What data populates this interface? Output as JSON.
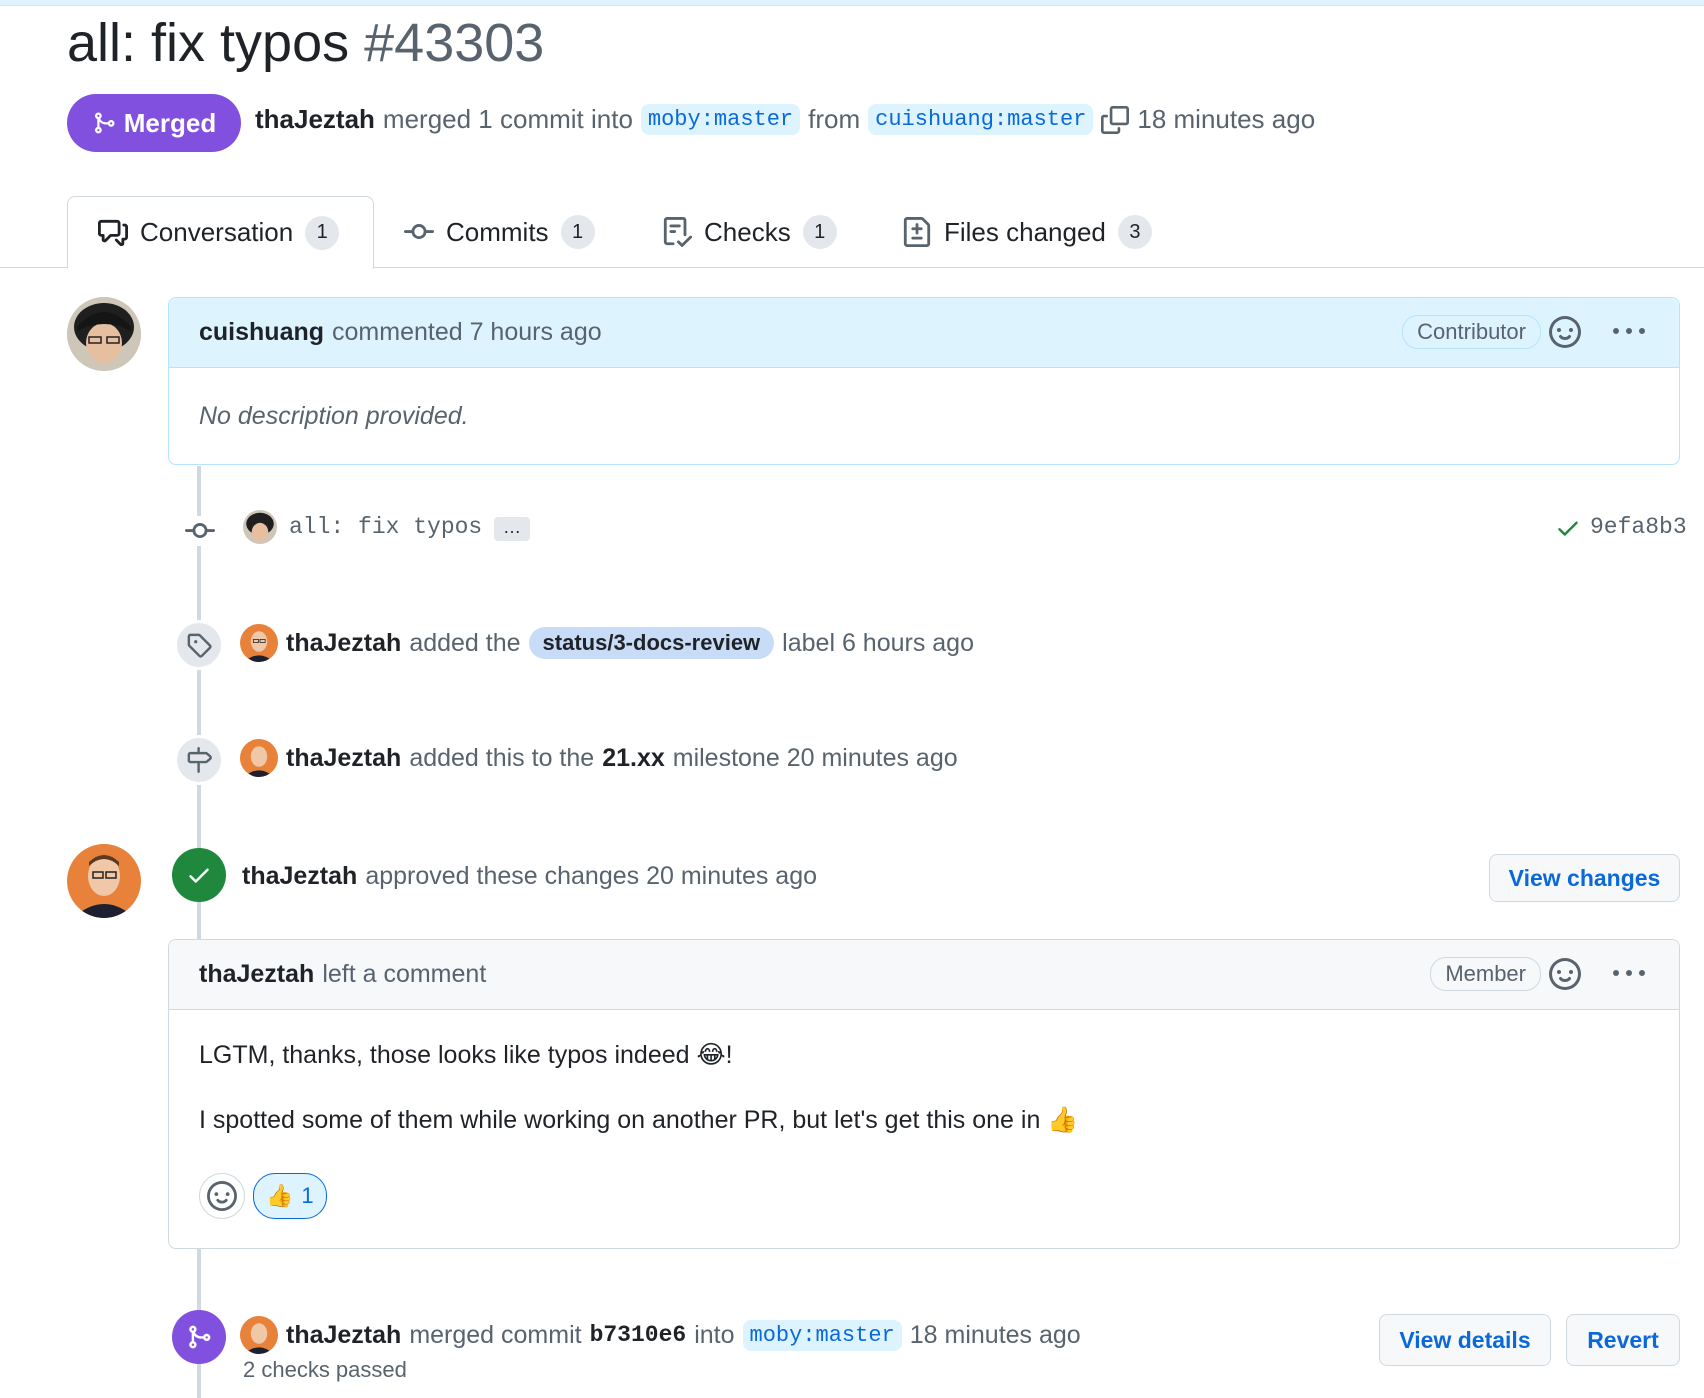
{
  "pr": {
    "title": "all: fix typos",
    "number": "#43303",
    "state_label": "Merged",
    "merger": "thaJeztah",
    "merge_text": "merged 1 commit into",
    "base_branch": "moby:master",
    "from_text": "from",
    "head_branch": "cuishuang:master",
    "time": "18 minutes ago"
  },
  "tabs": [
    {
      "label": "Conversation",
      "count": "1",
      "icon": "comment-discussion-icon"
    },
    {
      "label": "Commits",
      "count": "1",
      "icon": "git-commit-icon"
    },
    {
      "label": "Checks",
      "count": "1",
      "icon": "checklist-icon"
    },
    {
      "label": "Files changed",
      "count": "3",
      "icon": "file-diff-icon"
    }
  ],
  "first_comment": {
    "author": "cuishuang",
    "action": "commented 7 hours ago",
    "role": "Contributor",
    "body": "No description provided."
  },
  "commit_event": {
    "message": "all: fix typos",
    "more": "…",
    "sha": "9efa8b3"
  },
  "label_event": {
    "actor": "thaJeztah",
    "pre": "added the",
    "label": "status/3-docs-review",
    "post": "label 6 hours ago"
  },
  "milestone_event": {
    "actor": "thaJeztah",
    "pre": "added this to the",
    "milestone": "21.xx",
    "post": "milestone 20 minutes ago"
  },
  "review": {
    "actor": "thaJeztah",
    "action": "approved these changes 20 minutes ago",
    "button": "View changes",
    "comment_author": "thaJeztah",
    "comment_action": "left a comment",
    "role": "Member",
    "line1": "LGTM, thanks, those looks like typos indeed 😂!",
    "line2": "I spotted some of them while working on another PR, but let's get this one in 👍",
    "reaction_emoji": "👍",
    "reaction_count": "1"
  },
  "merge_event": {
    "actor": "thaJeztah",
    "pre": "merged commit",
    "sha": "b7310e6",
    "into": "into",
    "branch": "moby:master",
    "time": "18 minutes ago",
    "checks": "2 checks passed",
    "view_details": "View details",
    "revert": "Revert"
  },
  "colors": {
    "merged": "#8250df",
    "approved": "#1f883d",
    "link": "#0969da"
  }
}
